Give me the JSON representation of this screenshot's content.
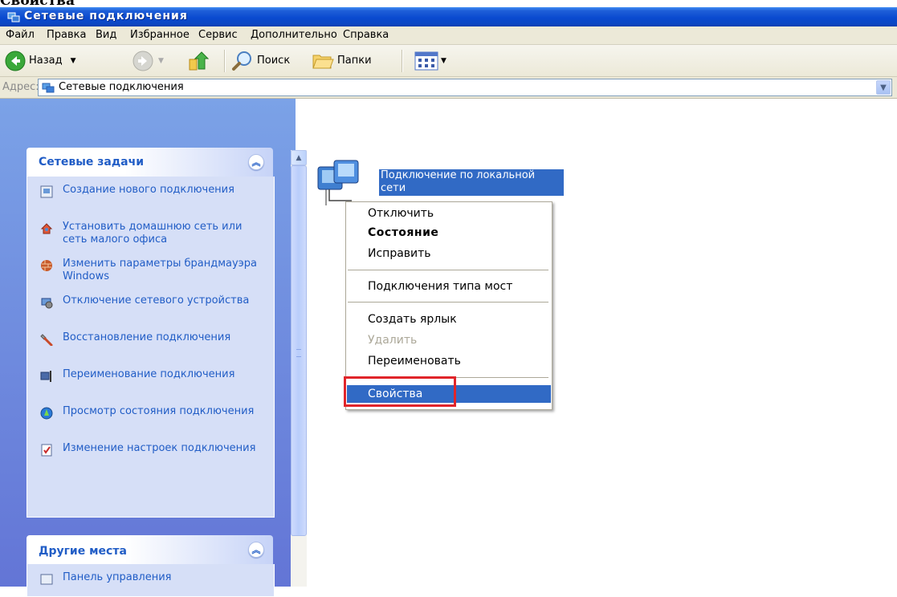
{
  "caption": "Свойства",
  "window": {
    "title": "Сетевые подключения"
  },
  "menu": [
    "Файл",
    "Правка",
    "Вид",
    "Избранное",
    "Сервис",
    "Дополнительно",
    "Справка"
  ],
  "toolbar": {
    "back_label": "Назад",
    "search_label": "Поиск",
    "folders_label": "Папки",
    "icons": [
      "back-icon",
      "forward-icon",
      "up-folder-icon",
      "search-icon",
      "folders-icon",
      "views-icon"
    ]
  },
  "address": {
    "label": "Адрес:",
    "value": "Сетевые подключения"
  },
  "left": {
    "network_tasks_title": "Сетевые задачи",
    "tasks": [
      "Создание нового подключения",
      "Установить домашнюю сеть или сеть малого офиса",
      "Изменить параметры брандмауэра Windows",
      "Отключение сетевого устройства",
      "Восстановление подключения",
      "Переименование подключения",
      "Просмотр состояния подключения",
      "Изменение настроек подключения"
    ],
    "other_places_title": "Другие места",
    "other_places_first": "Панель управления"
  },
  "connection": {
    "label": "Подключение по локальной сети"
  },
  "context_menu": {
    "items": [
      {
        "label": "Отключить",
        "state": "normal"
      },
      {
        "label": "Состояние",
        "state": "bold"
      },
      {
        "label": "Исправить",
        "state": "normal"
      },
      {
        "label": "Подключения типа мост",
        "state": "normal"
      },
      {
        "label": "Создать ярлык",
        "state": "normal"
      },
      {
        "label": "Удалить",
        "state": "disabled"
      },
      {
        "label": "Переименовать",
        "state": "normal"
      },
      {
        "label": "Свойства",
        "state": "selected"
      }
    ]
  },
  "colors": {
    "selection": "#316ac5",
    "highlight_box": "#e0252a",
    "link": "#215dc6"
  }
}
